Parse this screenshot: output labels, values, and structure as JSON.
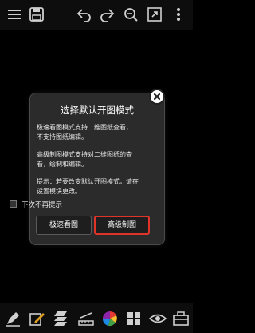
{
  "toolbar": {
    "icons": [
      "menu-icon",
      "save-icon",
      "undo-icon",
      "redo-icon",
      "zoom-icon",
      "fullscreen-icon",
      "more-icon"
    ]
  },
  "dialog": {
    "title": "选择默认开图模式",
    "quick_desc": "极速看图模式支持二维图纸查看，\n不支持图纸编辑。",
    "advanced_desc": "高级制图模式支持对二维图纸的查\n看，绘制和编辑。",
    "tip": "提示：若要改变默认开图模式，请在\n设置模块更改。",
    "checkbox_label": "下次不再提示",
    "quick_button": "极速看图",
    "advanced_button": "高级制图",
    "highlight_color": "#e0342a"
  },
  "bottom_toolbar": {
    "icons": [
      "draw-icon",
      "edit-icon",
      "layer-icon",
      "measure-icon",
      "color-icon",
      "blocks-icon",
      "view-icon",
      "toolbox-icon"
    ]
  }
}
